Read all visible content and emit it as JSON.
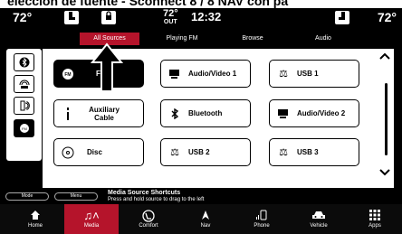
{
  "caption": "elección de fuente - Sconnect 8 / 8 NAV con pa",
  "status": {
    "temp_left": "72°",
    "temp_right": "72°",
    "outside_temp": "72°",
    "outside_label": "OUT",
    "time": "12:32"
  },
  "tabs": [
    {
      "label": "All Sources",
      "active": true
    },
    {
      "label": "Playing FM",
      "active": false
    },
    {
      "label": "Browse",
      "active": false
    },
    {
      "label": "Audio",
      "active": false
    }
  ],
  "sources": [
    {
      "label": "FM",
      "icon": "radio-icon",
      "selected": true
    },
    {
      "label": "Audio/Video 1",
      "icon": "video-icon",
      "selected": false
    },
    {
      "label": "USB 1",
      "icon": "usb-icon",
      "selected": false
    },
    {
      "label": "Auxiliary Cable",
      "icon": "aux-icon",
      "selected": false
    },
    {
      "label": "Bluetooth",
      "icon": "bluetooth-icon",
      "selected": false
    },
    {
      "label": "Audio/Video 2",
      "icon": "video-icon",
      "selected": false
    },
    {
      "label": "Disc",
      "icon": "disc-icon",
      "selected": false
    },
    {
      "label": "USB 2",
      "icon": "usb-icon",
      "selected": false
    },
    {
      "label": "USB 3",
      "icon": "usb-icon",
      "selected": false
    }
  ],
  "shortcut": {
    "mode_label": "Mode",
    "menu_label": "Menu",
    "title": "Media Source Shortcuts",
    "subtitle": "Press and hold source to drag to the left"
  },
  "nav": [
    {
      "label": "Home",
      "icon": "home-icon",
      "active": false
    },
    {
      "label": "Media",
      "icon": "music-icon",
      "active": true
    },
    {
      "label": "Comfort",
      "icon": "seat-icon",
      "active": false
    },
    {
      "label": "Nav",
      "icon": "navigation-icon",
      "active": false
    },
    {
      "label": "Phone",
      "icon": "phone-icon",
      "active": false
    },
    {
      "label": "Vehicle",
      "icon": "car-icon",
      "active": false
    },
    {
      "label": "Apps",
      "icon": "apps-grid-icon",
      "active": false
    }
  ],
  "colors": {
    "accent": "#b5142b",
    "background": "#000000",
    "panel": "#ffffff"
  }
}
